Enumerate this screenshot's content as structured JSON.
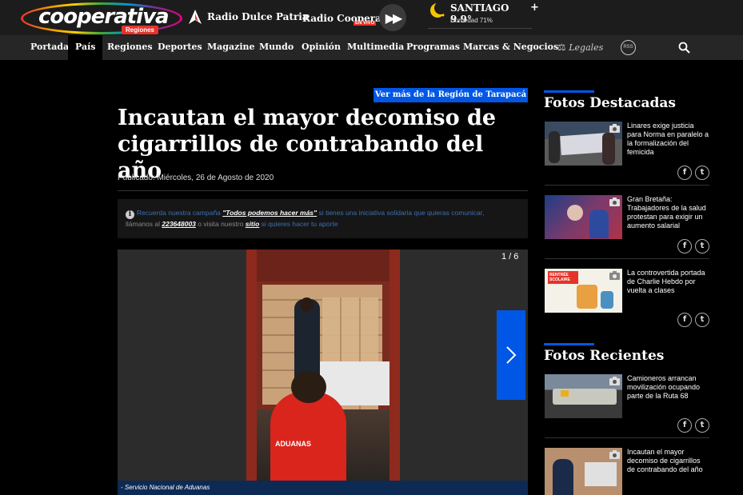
{
  "header": {
    "logo_text": "cooperativa",
    "logo_badge": "Regiones",
    "radio1_label": "Radio Dulce Patria",
    "radio2_label": "Radio Cooperativa",
    "radio2_live": "EN VIVO",
    "weather_city": "SANTIAGO 9.9°",
    "weather_humidity": "Humedad 71%",
    "weather_plus": "+"
  },
  "nav": {
    "items": [
      "Portada",
      "País",
      "Regiones",
      "Deportes",
      "Magazine",
      "Mundo",
      "Opinión",
      "Multimedia",
      "Programas",
      "Marcas & Negocios"
    ],
    "active": "País",
    "legales": "Legales",
    "circle_icon_text": "RSS"
  },
  "article": {
    "region_tag": "Ver más de la Región de Tarapacá",
    "headline": "Incautan el mayor decomiso de cigarrillos de contrabando del año",
    "published": "Publicado: Miércoles, 26 de Agosto de 2020",
    "campaign": {
      "part1": "Recuerda nuestra campaña ",
      "link1": "\"Todos podemos hacer más\"",
      "part2": " si tienes una iniciativa solidaria que quieras comunicar,",
      "part3": "llámanos al ",
      "phone": "223648003",
      "part4": " o visita nuestro ",
      "link2": "sitio",
      "part5": " si quieres hacer tu aporte"
    },
    "gallery": {
      "counter": "1 / 6",
      "caption": "- Servicio Nacional de Aduanas",
      "photo_label": "ADUANAS"
    }
  },
  "sidebar": {
    "featured_title": "Fotos Destacadas",
    "featured": [
      {
        "title": "Linares exige justicia para Norma en paralelo a la formalización del femicida"
      },
      {
        "title": "Gran Bretaña: Trabajadores de la salud protestan para exigir un aumento salarial"
      },
      {
        "title": "La controvertida portada de Charlie Hebdo por vuelta a clases"
      }
    ],
    "recent_title": "Fotos Recientes",
    "recent": [
      {
        "title": "Camioneros arrancan movilización ocupando parte de la Ruta 68"
      },
      {
        "title": "Incautan el mayor decomiso de cigarrillos de contrabando del año"
      }
    ],
    "thumb3_text": "RENTRÉE SCOLAIRE"
  },
  "colors": {
    "accent": "#0057e6",
    "topbar": "#1c1c1c",
    "navbar": "#262626",
    "live": "#e6332a"
  }
}
